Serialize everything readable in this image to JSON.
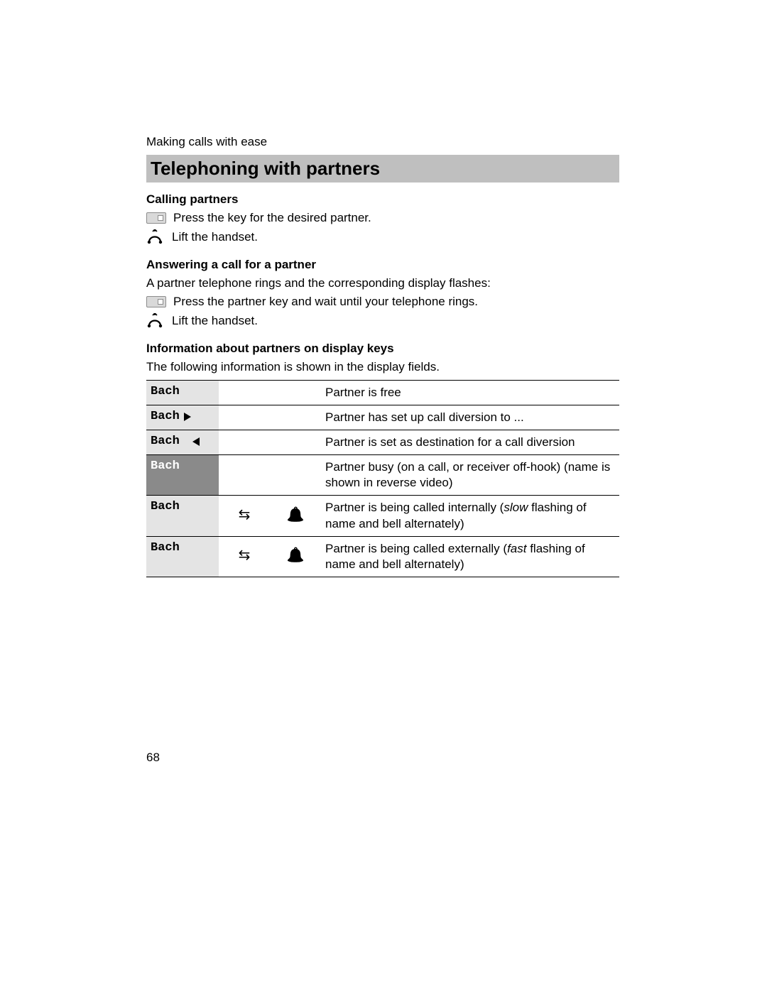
{
  "running_head": "Making calls with ease",
  "title": "Telephoning with partners",
  "page_number": "68",
  "sections": {
    "calling": {
      "heading": "Calling partners",
      "step_press": "Press the key for the desired partner.",
      "step_lift": "Lift the handset."
    },
    "answering": {
      "heading": "Answering a call for a partner",
      "intro": "A partner telephone rings and the corresponding display flashes:",
      "step_press": "Press the partner key and wait until your telephone rings.",
      "step_lift": "Lift the handset."
    },
    "info": {
      "heading": "Information about partners on display keys",
      "intro": "The following information is shown in the display fields."
    }
  },
  "table": {
    "rows": [
      {
        "label": "Bach",
        "arrow": "none",
        "inverse": false,
        "swap": false,
        "bell": false,
        "desc_pre": "Partner is free",
        "desc_em": "",
        "desc_post": ""
      },
      {
        "label": "Bach",
        "arrow": "right",
        "inverse": false,
        "swap": false,
        "bell": false,
        "desc_pre": "Partner has set up call diversion to ...",
        "desc_em": "",
        "desc_post": ""
      },
      {
        "label": "Bach",
        "arrow": "left",
        "inverse": false,
        "swap": false,
        "bell": false,
        "desc_pre": "Partner is set as destination for a call diversion",
        "desc_em": "",
        "desc_post": ""
      },
      {
        "label": "Bach",
        "arrow": "none",
        "inverse": true,
        "swap": false,
        "bell": false,
        "desc_pre": "Partner busy (on a call, or receiver off-hook) (name is shown in reverse video)",
        "desc_em": "",
        "desc_post": ""
      },
      {
        "label": "Bach",
        "arrow": "none",
        "inverse": false,
        "swap": true,
        "bell": true,
        "desc_pre": "Partner is being called internally (",
        "desc_em": "slow",
        "desc_post": " flashing of name and bell alternately)"
      },
      {
        "label": "Bach",
        "arrow": "none",
        "inverse": false,
        "swap": true,
        "bell": true,
        "desc_pre": "Partner is being called externally (",
        "desc_em": "fast",
        "desc_post": " flashing of name and bell alternately)"
      }
    ]
  }
}
